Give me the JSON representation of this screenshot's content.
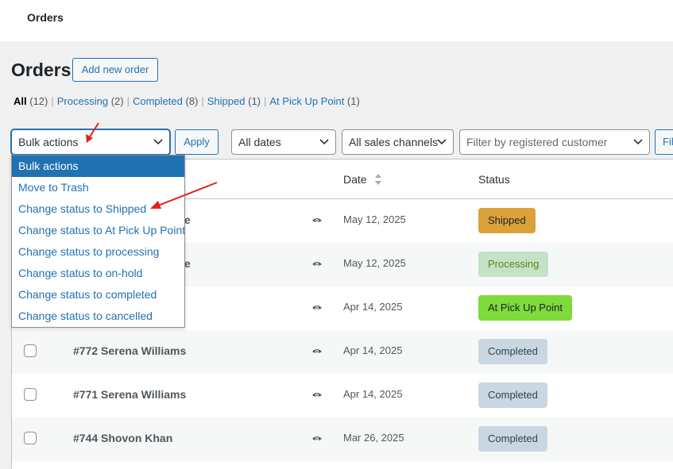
{
  "topbar": {
    "title": "Orders"
  },
  "header": {
    "title": "Orders",
    "add_button": "Add new order"
  },
  "filters_links": [
    {
      "label": "All",
      "count": "(12)",
      "current": true
    },
    {
      "label": "Processing",
      "count": "(2)",
      "current": false
    },
    {
      "label": "Completed",
      "count": "(8)",
      "current": false
    },
    {
      "label": "Shipped",
      "count": "(1)",
      "current": false
    },
    {
      "label": "At Pick Up Point",
      "count": "(1)",
      "current": false
    }
  ],
  "toolbar": {
    "bulk_actions": "Bulk actions",
    "apply": "Apply",
    "dates": "All dates",
    "channels": "All sales channels",
    "customer_placeholder": "Filter by registered customer",
    "filter_button": "Filter"
  },
  "dropdown": {
    "options": [
      "Bulk actions",
      "Move to Trash",
      "Change status to Shipped",
      "Change status to At Pick Up Point",
      "Change status to processing",
      "Change status to on-hold",
      "Change status to completed",
      "Change status to cancelled"
    ],
    "selected_index": 0
  },
  "table": {
    "columns": {
      "date": "Date",
      "status": "Status"
    },
    "rows": [
      {
        "name": "",
        "name_tail": "e",
        "date": "May 12, 2025",
        "status": "Shipped",
        "status_bg": "#dba23a",
        "status_fg": "#1d2327"
      },
      {
        "name": "",
        "name_tail": "e",
        "date": "May 12, 2025",
        "status": "Processing",
        "status_bg": "#c6e1c6",
        "status_fg": "#5b841b"
      },
      {
        "name": "",
        "name_tail": "",
        "date": "Apr 14, 2025",
        "status": "At Pick Up Point",
        "status_bg": "#7ddb3c",
        "status_fg": "#1d2327"
      },
      {
        "name": "#772 Serena Williams",
        "date": "Apr 14, 2025",
        "status": "Completed",
        "status_bg": "#c8d7e1",
        "status_fg": "#2e4453"
      },
      {
        "name": "#771 Serena Williams",
        "date": "Apr 14, 2025",
        "status": "Completed",
        "status_bg": "#c8d7e1",
        "status_fg": "#2e4453"
      },
      {
        "name": "#744 Shovon Khan",
        "date": "Mar 26, 2025",
        "status": "Completed",
        "status_bg": "#c8d7e1",
        "status_fg": "#2e4453"
      }
    ]
  },
  "colors": {
    "accent": "#2271b1",
    "annotation": "#e02020"
  },
  "icons": {
    "chevron": "chevron-down-icon",
    "eye": "eye-icon",
    "sort": "sort-icon"
  }
}
